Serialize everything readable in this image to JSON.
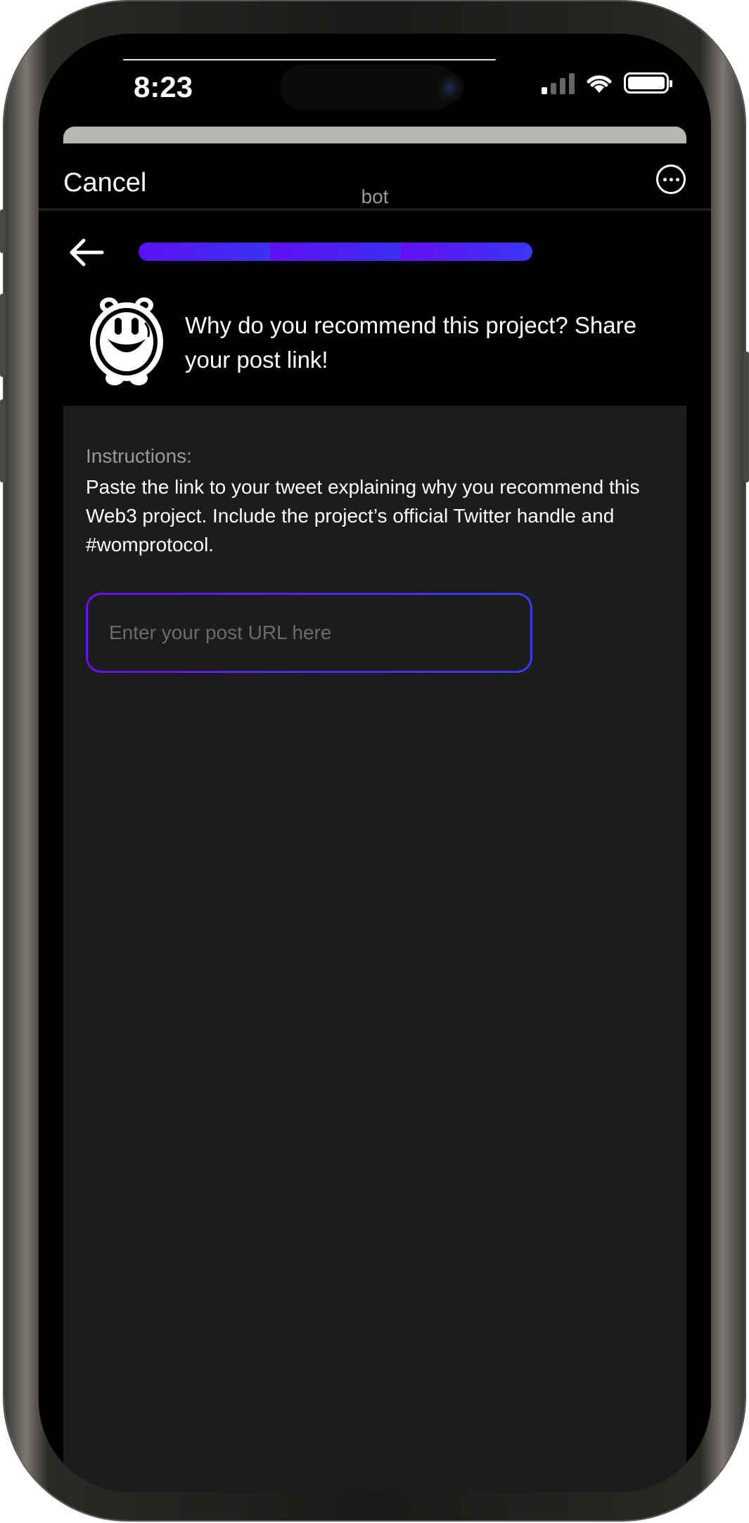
{
  "status_bar": {
    "time": "8:23"
  },
  "nav": {
    "cancel_label": "Cancel",
    "title": "bot",
    "more_icon": "ellipsis-circle-icon"
  },
  "progress": {
    "segments_total": 3,
    "segments_complete": 3,
    "back_icon": "arrow-left-icon"
  },
  "header": {
    "mascot_icon": "smiley-mascot-icon",
    "question": "Why do you recommend this project? Share your post link!"
  },
  "instructions": {
    "label": "Instructions:",
    "text": "Paste the link to your tweet explaining why you recommend this Web3 project. Include the project’s official Twitter handle and #womprotocol."
  },
  "url_input": {
    "value": "",
    "placeholder": "Enter your post URL here"
  },
  "colors": {
    "background": "#000000",
    "panel": "#1c1c1e",
    "accent_purple": "#6a10f0",
    "accent_blue": "#3a3af2",
    "muted_text": "#9a9a9a"
  }
}
